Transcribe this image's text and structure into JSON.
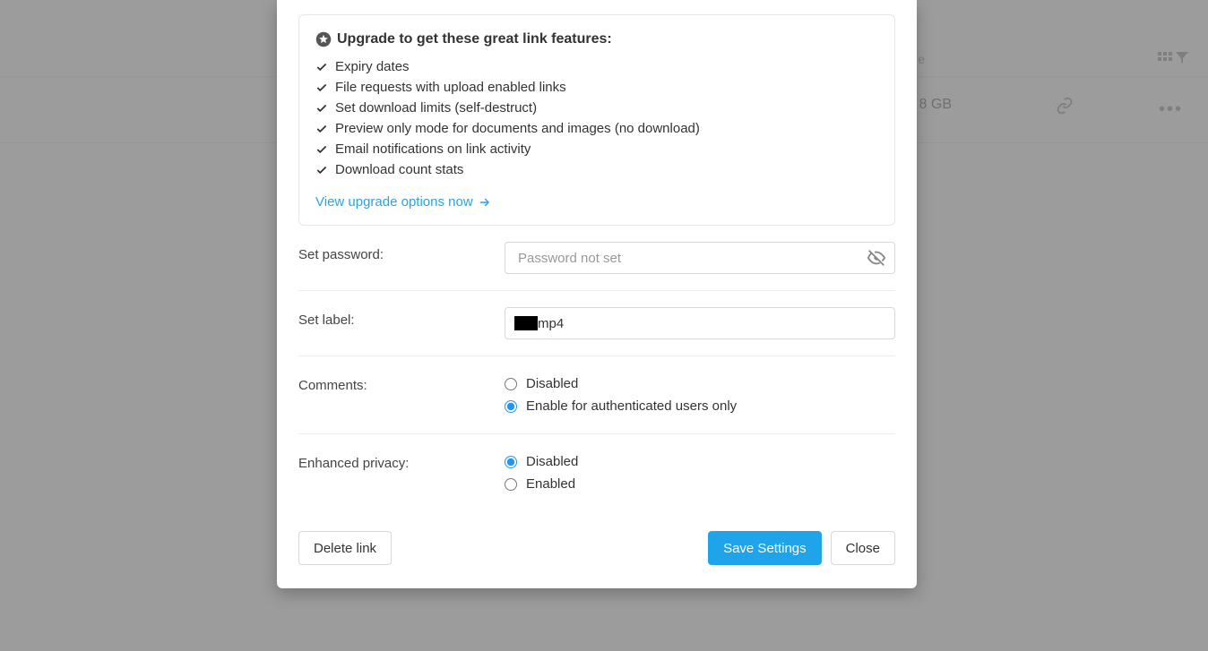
{
  "background": {
    "header_right_text_suffix": "e",
    "row_size": "8 GB"
  },
  "modal": {
    "callout": {
      "title": "Upgrade to get these great link features:",
      "features": [
        "Expiry dates",
        "File requests with upload enabled links",
        "Set download limits (self-destruct)",
        "Preview only mode for documents and images (no download)",
        "Email notifications on link activity",
        "Download count stats"
      ],
      "upgrade_link": "View upgrade options now"
    },
    "password": {
      "label": "Set password:",
      "placeholder": "Password not set"
    },
    "label_field": {
      "label": "Set label:",
      "value_suffix": "mp4"
    },
    "comments": {
      "label": "Comments:",
      "options": {
        "disabled": "Disabled",
        "auth": "Enable for authenticated users only"
      },
      "selected": "auth"
    },
    "privacy": {
      "label": "Enhanced privacy:",
      "options": {
        "disabled": "Disabled",
        "enabled": "Enabled"
      },
      "selected": "disabled"
    },
    "footer": {
      "delete": "Delete link",
      "save": "Save Settings",
      "close": "Close"
    }
  }
}
